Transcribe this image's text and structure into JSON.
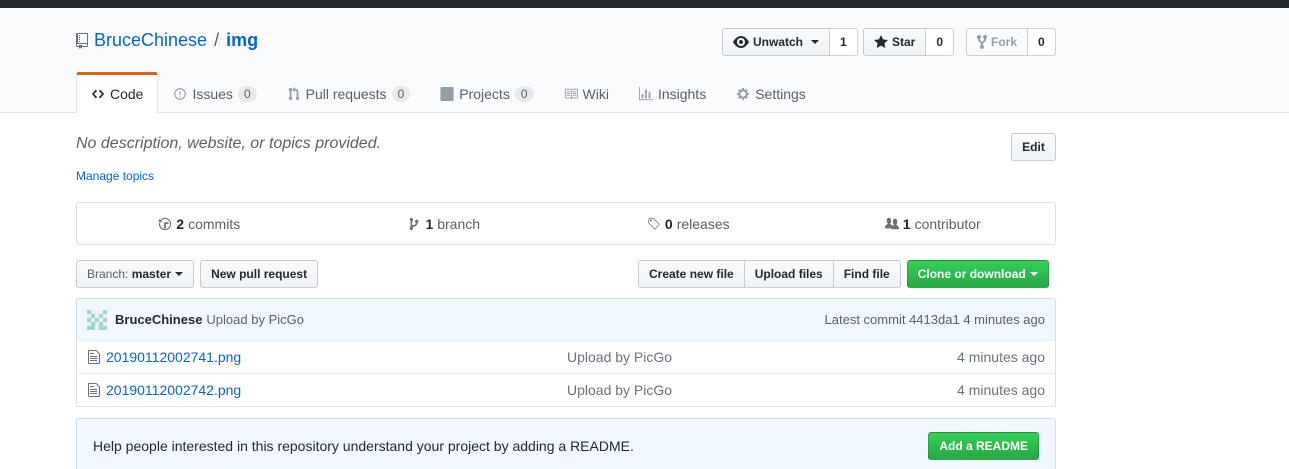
{
  "repo": {
    "owner": "BruceChinese",
    "separator": "/",
    "name": "img"
  },
  "actions": {
    "watch_label": "Unwatch",
    "watch_count": "1",
    "star_label": "Star",
    "star_count": "0",
    "fork_label": "Fork",
    "fork_count": "0"
  },
  "tabs": [
    {
      "label": "Code"
    },
    {
      "label": "Issues",
      "count": "0"
    },
    {
      "label": "Pull requests",
      "count": "0"
    },
    {
      "label": "Projects",
      "count": "0"
    },
    {
      "label": "Wiki"
    },
    {
      "label": "Insights"
    },
    {
      "label": "Settings"
    }
  ],
  "description": "No description, website, or topics provided.",
  "manage_topics": "Manage topics",
  "edit_label": "Edit",
  "summary": {
    "commits_count": "2",
    "commits_label": "commits",
    "branch_count": "1",
    "branch_label": "branch",
    "releases_count": "0",
    "releases_label": "releases",
    "contributor_count": "1",
    "contributor_label": "contributor"
  },
  "filebar": {
    "branch_prefix": "Branch:",
    "branch_name": "master",
    "new_pr": "New pull request",
    "create_file": "Create new file",
    "upload_files": "Upload files",
    "find_file": "Find file",
    "clone": "Clone or download"
  },
  "latest_commit": {
    "author": "BruceChinese",
    "message": "Upload by PicGo",
    "prefix": "Latest commit",
    "sha": "4413da1",
    "age": "4 minutes ago"
  },
  "files": [
    {
      "name": "20190112002741.png",
      "message": "Upload by PicGo",
      "age": "4 minutes ago"
    },
    {
      "name": "20190112002742.png",
      "message": "Upload by PicGo",
      "age": "4 minutes ago"
    }
  ],
  "readme_prompt": {
    "text": "Help people interested in this repository understand your project by adding a README.",
    "button": "Add a README"
  },
  "colors": {
    "accent": "#0366d6",
    "tab_underline": "#e36209",
    "green": "#28a745",
    "dark": "#24292e"
  }
}
